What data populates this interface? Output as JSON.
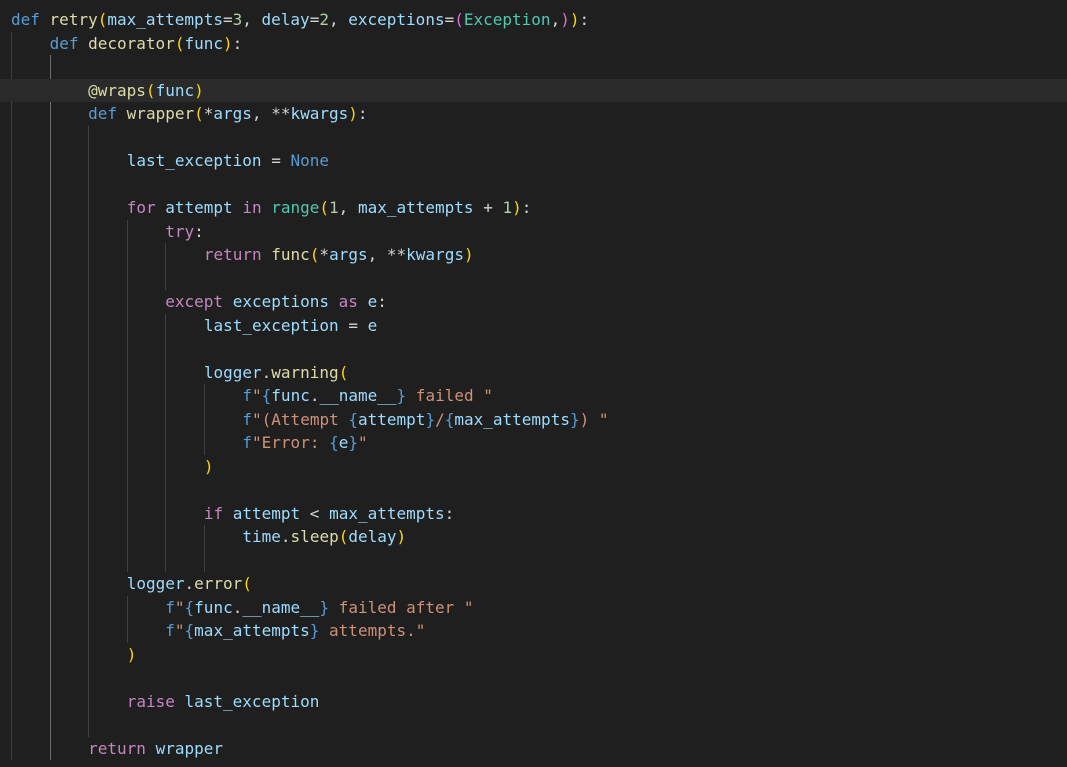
{
  "editor": {
    "language": "python",
    "theme_colors": {
      "background": "#1f1f1f",
      "current_line": "#2a2a2a",
      "keyword_control": "#c586c0",
      "keyword_storage": "#569cd6",
      "function": "#dcdcaa",
      "parameter": "#9cdcfe",
      "number": "#b5cea8",
      "string": "#ce9178",
      "class": "#4ec9b0",
      "bracket_level1": "#ffd700",
      "bracket_level2": "#da70d6",
      "bracket_level3": "#179fff"
    },
    "lines": [
      "def retry(max_attempts=3, delay=2, exceptions=(Exception,)):",
      "    def decorator(func):",
      "",
      "        @wraps(func)",
      "        def wrapper(*args, **kwargs):",
      "",
      "            last_exception = None",
      "",
      "            for attempt in range(1, max_attempts + 1):",
      "                try:",
      "                    return func(*args, **kwargs)",
      "",
      "                except exceptions as e:",
      "                    last_exception = e",
      "",
      "                    logger.warning(",
      "                        f\"{func.__name__} failed \"",
      "                        f\"(Attempt {attempt}/{max_attempts}) \"",
      "                        f\"Error: {e}\"",
      "                    )",
      "",
      "                    if attempt < max_attempts:",
      "                        time.sleep(delay)",
      "",
      "            logger.error(",
      "                f\"{func.__name__} failed after \"",
      "                f\"{max_attempts} attempts.\"",
      "            )",
      "",
      "            raise last_exception",
      "",
      "        return wrapper"
    ]
  }
}
